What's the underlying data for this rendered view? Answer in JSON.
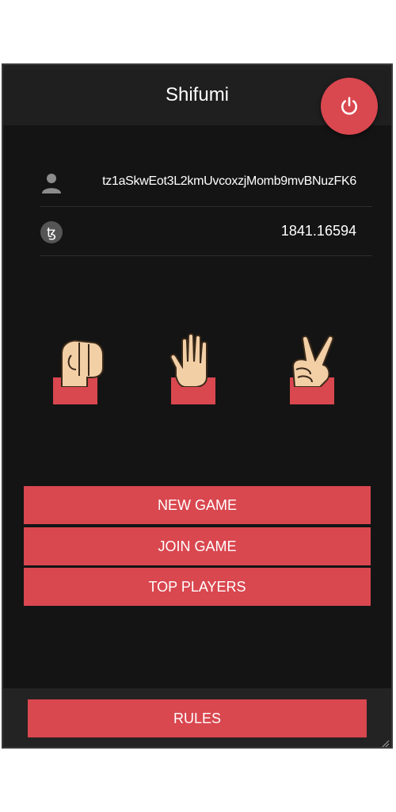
{
  "app": {
    "title": "Shifumi"
  },
  "account": {
    "address": "tz1aSkwEot3L2kmUvcoxzjMomb9mvBNuzFK6",
    "balance": "1841.16594"
  },
  "icons": {
    "power": "power-icon",
    "user": "user-icon",
    "tezos": "tezos-icon",
    "rock": "rock-hand-icon",
    "paper": "paper-hand-icon",
    "scissors": "scissors-hand-icon"
  },
  "menu": {
    "new_game": "NEW GAME",
    "join_game": "JOIN GAME",
    "top_players": "TOP PLAYERS"
  },
  "footer": {
    "rules": "RULES"
  },
  "colors": {
    "accent": "#d9474f",
    "background": "#141414",
    "header": "#1f1f1f",
    "skin": "#f3cfa6"
  }
}
